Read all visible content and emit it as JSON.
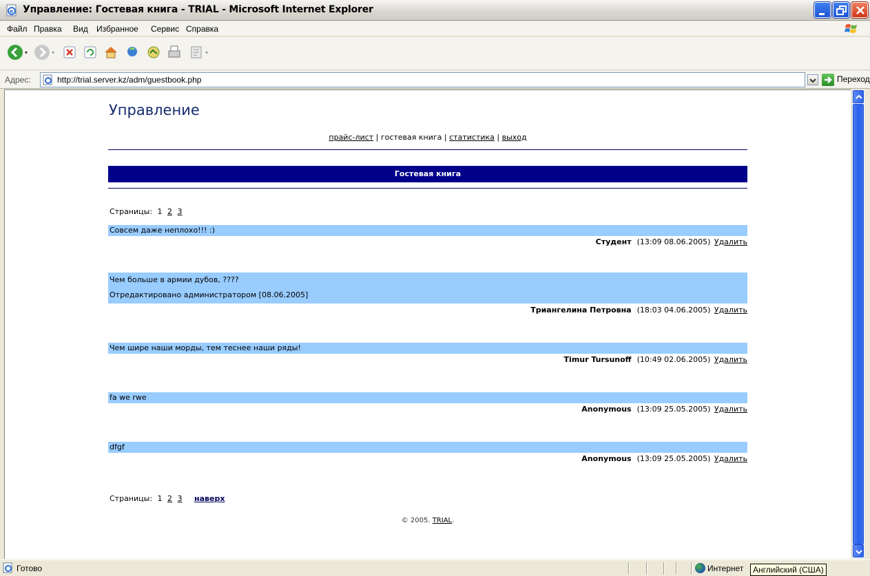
{
  "window": {
    "title": "Управление: Гостевая книга - TRIAL - Microsoft Internet Explorer",
    "buttons": [
      "minimize",
      "restore",
      "close"
    ]
  },
  "menu": {
    "items": [
      "Файл",
      "Правка",
      "Вид",
      "Избранное",
      "Сервис",
      "Справка"
    ]
  },
  "toolbar": {
    "icons": [
      "back-icon",
      "forward-icon",
      "stop-icon",
      "refresh-icon",
      "home-icon",
      "search-icon",
      "favorites-icon",
      "print-icon",
      "edit-icon"
    ]
  },
  "address": {
    "label": "Адрес:",
    "url": "http://trial.server.kz/adm/guestbook.php",
    "go_label": "Переход"
  },
  "page": {
    "heading": "Управление",
    "nav": {
      "price": "прайс-лист",
      "sep": "|",
      "guestbook": "гостевая книга",
      "stats": "статистика",
      "logout": "выход"
    },
    "banner": "Гостевая книга",
    "pages_label": "Страницы:",
    "pages": [
      "1",
      "2",
      "3"
    ],
    "top_link": "наверх",
    "delete_label": "Удалить",
    "entries": [
      {
        "lines": [
          "Совсем даже неплохо!!! :)"
        ],
        "author": "Студент",
        "datetime": "(13:09 08.06.2005)"
      },
      {
        "lines": [
          "Чем больше в армии дубов, ????",
          "",
          "Отредактировано администратором [08.06.2005]"
        ],
        "author": "Триангелина Петровна",
        "datetime": "(18:03 04.06.2005)"
      },
      {
        "lines": [
          "Чем шире наши морды, тем теснее наши ряды!"
        ],
        "author": "Timur Tursunoff",
        "datetime": "(10:49 02.06.2005)"
      },
      {
        "lines": [
          "fa we rwe"
        ],
        "author": "Anonymous",
        "datetime": "(13:09 25.05.2005)"
      },
      {
        "lines": [
          "dfgf"
        ],
        "author": "Anonymous",
        "datetime": "(13:09 25.05.2005)"
      }
    ],
    "footer_prefix": "© 2005.",
    "footer_link": "TRIAL",
    "footer_suffix": "."
  },
  "status": {
    "text": "Готово",
    "zone": "Интернет",
    "tooltip": "Английский (США)"
  },
  "colors": {
    "banner": "#00008b",
    "message_bg": "#99ccff",
    "rule": "#000066",
    "titlebar_close": "#cf3616"
  }
}
